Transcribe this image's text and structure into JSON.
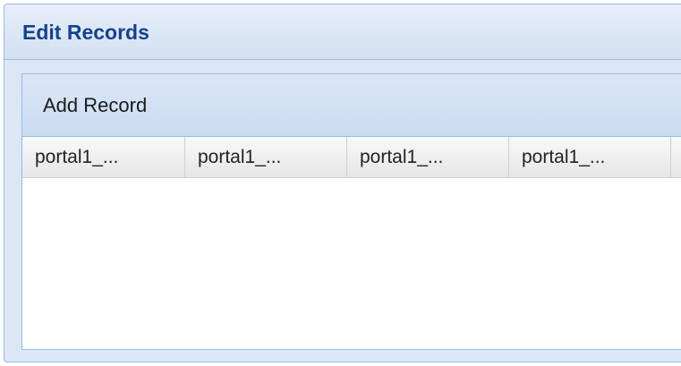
{
  "panel": {
    "title": "Edit Records"
  },
  "toolbar": {
    "add_record_label": "Add Record"
  },
  "grid": {
    "columns": [
      {
        "label": "portal1_..."
      },
      {
        "label": "portal1_..."
      },
      {
        "label": "portal1_..."
      },
      {
        "label": "portal1_..."
      }
    ],
    "rows": []
  },
  "colors": {
    "title_text": "#15428b",
    "border": "#99bbe8",
    "panel_bg": "#dce7f5"
  }
}
